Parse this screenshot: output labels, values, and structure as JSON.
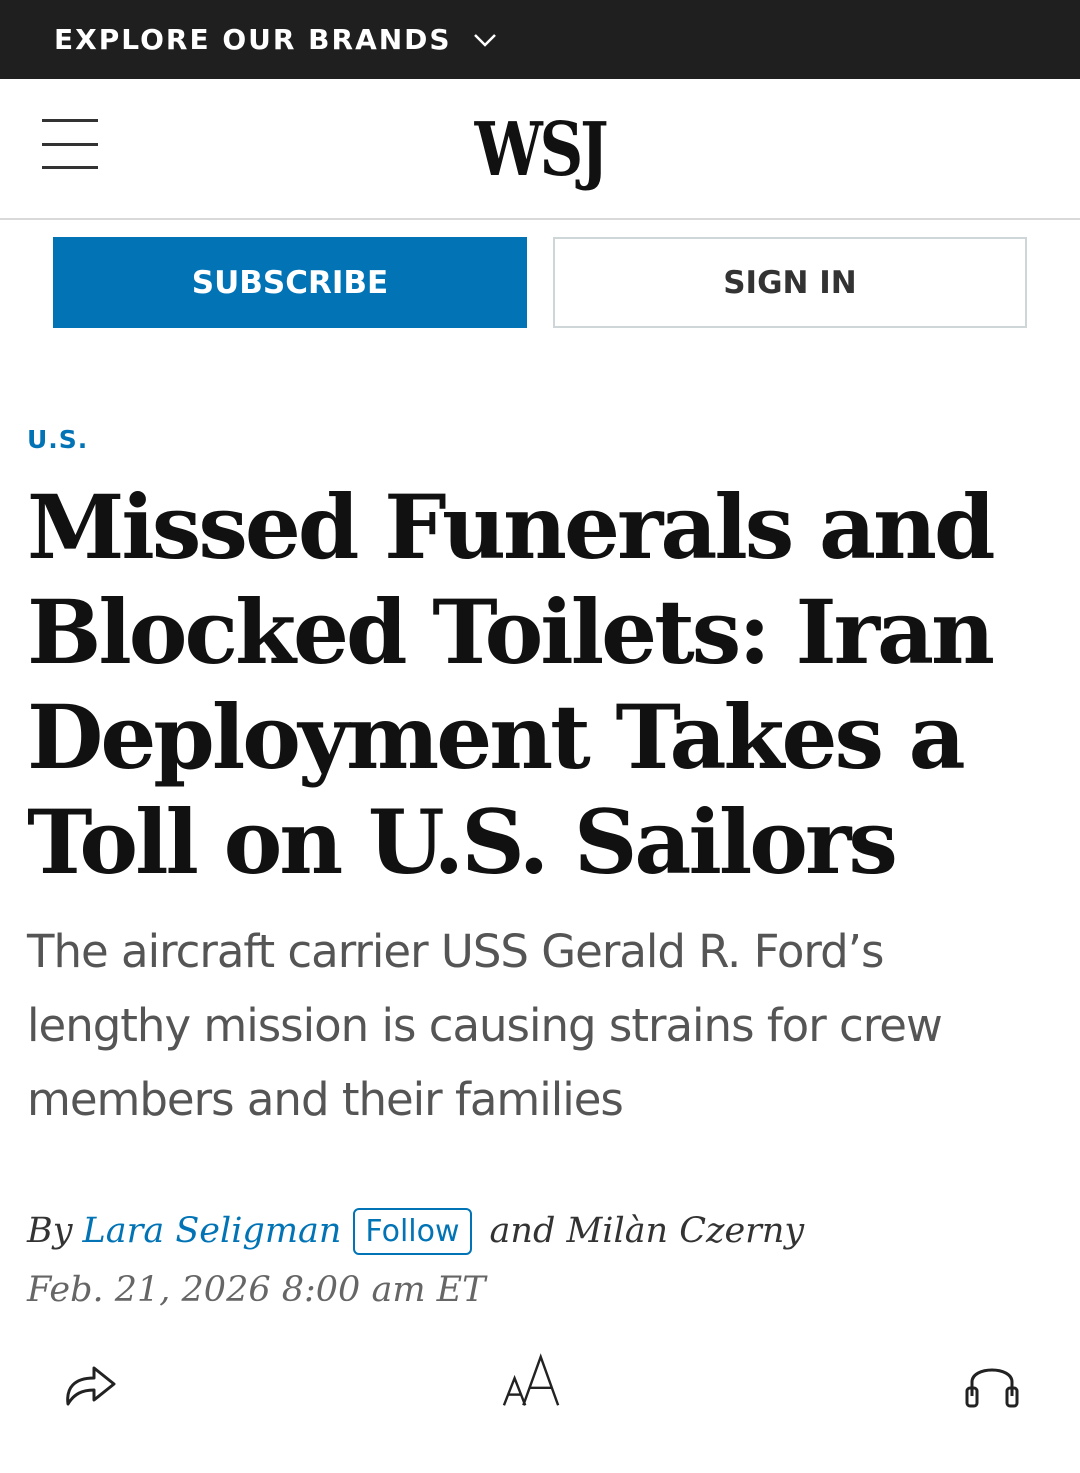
{
  "brand_bar": {
    "label": "EXPLORE OUR BRANDS"
  },
  "masthead": {
    "logo": "WSJ"
  },
  "buttons": {
    "subscribe": "SUBSCRIBE",
    "sign_in": "SIGN IN"
  },
  "article": {
    "section": "U.S.",
    "headline": "Missed Funerals and Blocked Toilets: Iran Deployment Takes a Toll on U.S. Sailors",
    "dek": "The aircraft carrier USS Gerald R. Ford’s lengthy mission is causing strains for crew members and their families",
    "byline": {
      "by": "By",
      "author1": "Lara Seligman",
      "follow": "Follow",
      "author2": "and Milàn Czerny"
    },
    "timestamp": "Feb. 21, 2026 8:00 am ET"
  },
  "toolbar": {
    "icons": [
      "share-icon",
      "text-size-icon",
      "headphones-icon"
    ]
  },
  "colors": {
    "brand_bar_bg": "#1f1f1f",
    "accent_blue": "#0274b6",
    "dek_gray": "#555555"
  }
}
